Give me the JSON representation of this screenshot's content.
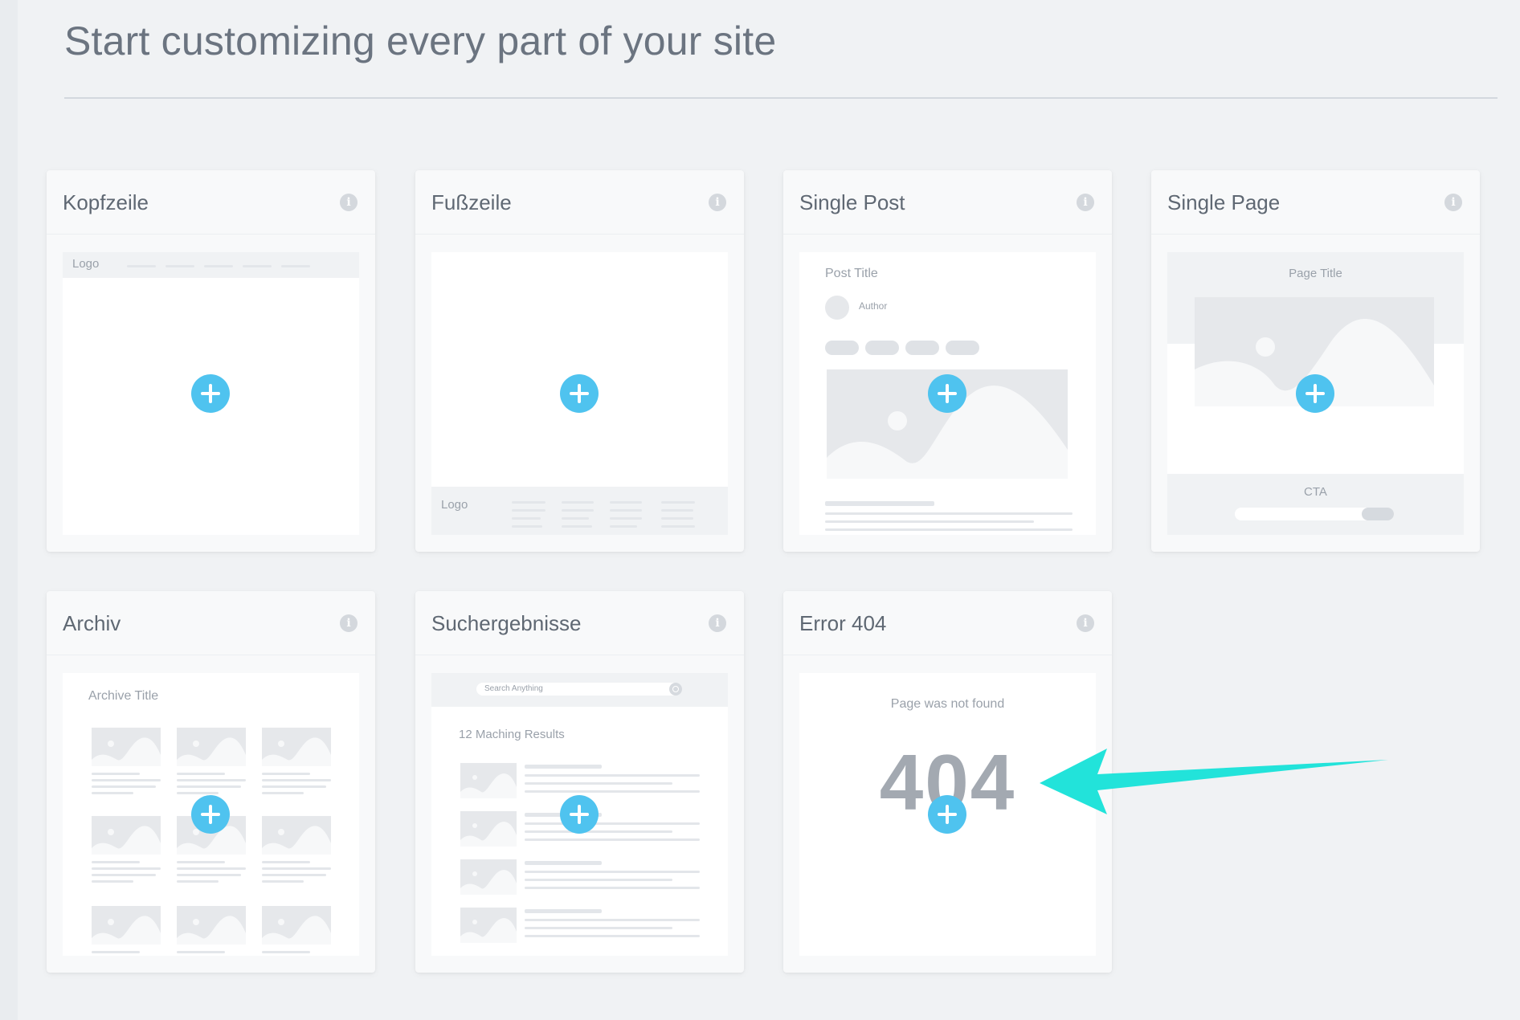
{
  "page": {
    "title": "Start customizing every part of your site"
  },
  "cards": {
    "kopfzeile": {
      "title": "Kopfzeile",
      "logo": "Logo"
    },
    "fusszeile": {
      "title": "Fußzeile",
      "logo": "Logo"
    },
    "single_post": {
      "title": "Single Post",
      "post_title": "Post Title",
      "author": "Author"
    },
    "single_page": {
      "title": "Single Page",
      "page_title": "Page Title",
      "cta": "CTA"
    },
    "archiv": {
      "title": "Archiv",
      "archive_title": "Archive Title"
    },
    "suchergebnisse": {
      "title": "Suchergebnisse",
      "search_placeholder": "Search Anything",
      "results": "12 Maching Results"
    },
    "error_404": {
      "title": "Error 404",
      "message": "Page was not found",
      "code": "404"
    }
  },
  "icons": {
    "info": "info-icon",
    "add": "plus-icon",
    "pointer": "arrow-icon"
  },
  "colors": {
    "accent": "#4fc3ef",
    "arrow": "#22e3da",
    "background": "#f0f2f4",
    "card": "#f8f9fa"
  }
}
